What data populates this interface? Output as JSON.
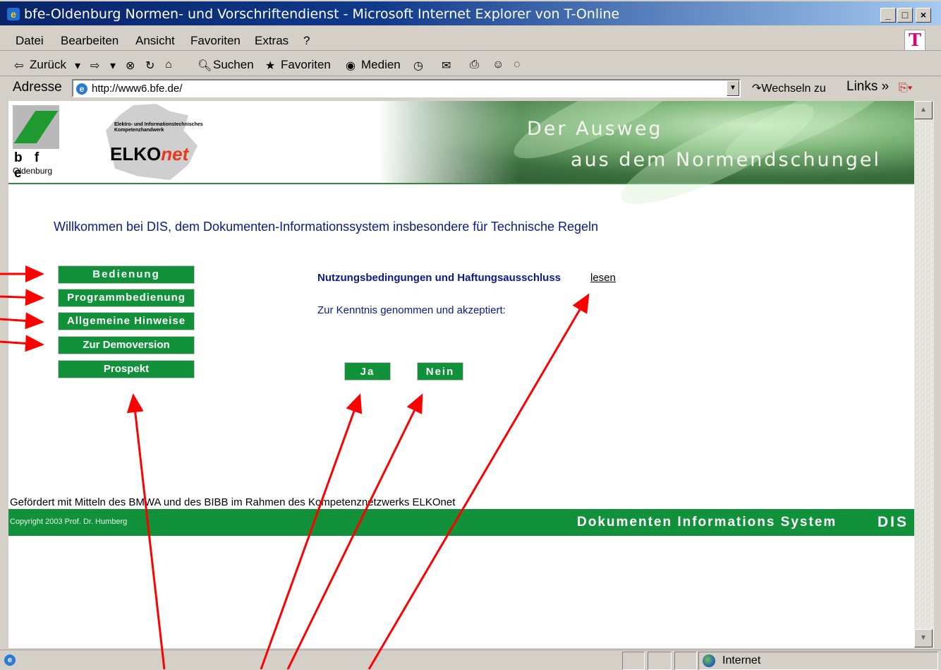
{
  "window": {
    "title": "bfe-Oldenburg Normen- und Vorschriftendienst - Microsoft Internet Explorer von T-Online",
    "controls": [
      "_",
      "□",
      "×"
    ]
  },
  "menu": [
    "Datei",
    "Bearbeiten",
    "Ansicht",
    "Favoriten",
    "Extras",
    "?"
  ],
  "toolbar": {
    "back": "Zurück",
    "search": "Suchen",
    "favorites": "Favoriten",
    "media": "Medien"
  },
  "address": {
    "label": "Adresse",
    "url": "http://www6.bfe.de/",
    "go": "Wechseln zu",
    "links": "Links"
  },
  "banner": {
    "bfe_logo": "b f e",
    "bfe_city": "Oldenburg",
    "elko_small": "Elektro- und Informationstechnisches Kompetenzhandwerk",
    "elko_main": "ELKO",
    "elko_suffix": "net",
    "slogan_line1": "Der Ausweg",
    "slogan_line2": "aus dem Normendschungel"
  },
  "main": {
    "welcome": "Willkommen bei DIS, dem Dokumenten-Informationssystem insbesondere für Technische Regeln",
    "nav": [
      "Bedienung",
      "Programmbedienung",
      "Allgemeine Hinweise",
      "Zur Demoversion",
      "Prospekt"
    ],
    "terms_text": "Nutzungsbedingungen und Haftungsausschluss",
    "terms_link": "lesen",
    "accept_text": "Zur Kenntnis genommen und akzeptiert:",
    "yes": "Ja",
    "no": "Nein"
  },
  "footer": {
    "funding": "Gefördert mit Mitteln des BMWA und des BIBB im Rahmen des Kompetenznetzwerks ELKOnet",
    "copyright": "Copyright 2003 Prof. Dr. Humberg",
    "system_name": "Dokumenten Informations System",
    "system_abbr": "DIS"
  },
  "status": {
    "zone": "Internet"
  },
  "colors": {
    "button_green": "#119139",
    "text_blue": "#0a1a8a",
    "arrow_red": "#ff0000"
  }
}
